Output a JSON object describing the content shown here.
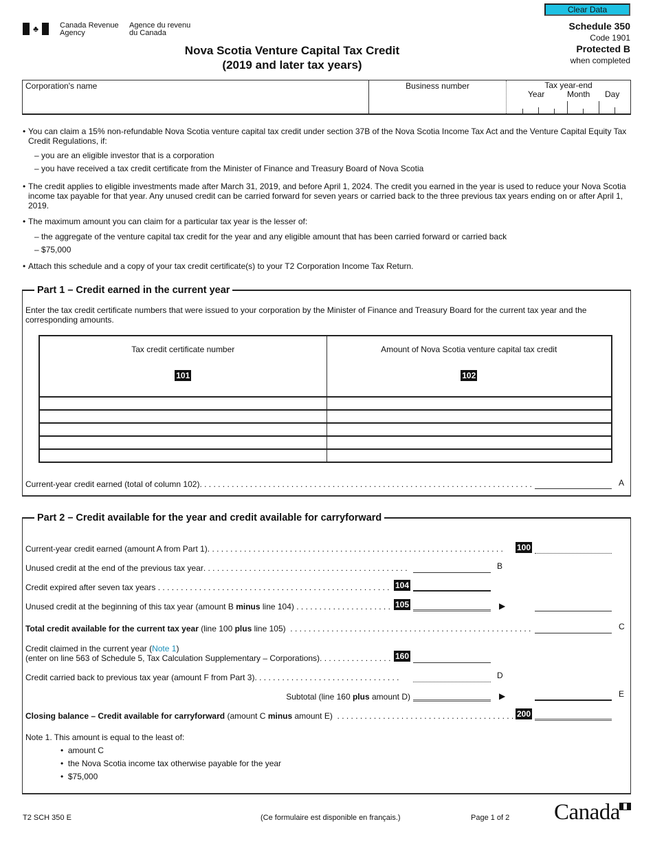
{
  "header": {
    "agency_en_line1": "Canada Revenue",
    "agency_en_line2": "Agency",
    "agency_fr_line1": "Agence du revenu",
    "agency_fr_line2": "du Canada",
    "clear_button": "Clear Data",
    "schedule": "Schedule 350",
    "code": "Code 1901",
    "protected": "Protected B",
    "when_completed": "when completed",
    "title_line1": "Nova Scotia Venture Capital Tax Credit",
    "title_line2": "(2019 and later tax years)"
  },
  "identification": {
    "corporation_name_label": "Corporation's name",
    "corporation_name_value": "",
    "business_number_label": "Business number",
    "business_number_value": "",
    "tax_year_end_label": "Tax year-end",
    "year_label": "Year",
    "month_label": "Month",
    "day_label": "Day"
  },
  "intro": {
    "bullet1": "You can claim a 15% non-refundable Nova Scotia venture capital tax credit under section 37B of the Nova Scotia Income Tax Act and the Venture Capital Equity Tax Credit Regulations, if:",
    "bullet1_sub1": "you are an eligible investor that is a corporation",
    "bullet1_sub2": "you have received a tax credit certificate from the Minister of Finance and Treasury Board of Nova Scotia",
    "bullet2": "The credit applies to eligible investments made after March 31, 2019, and before April 1, 2024. The credit you earned in the year is used to reduce your Nova Scotia income tax payable for that year. Any unused credit can be carried forward for seven years or carried back to the three previous tax years ending on or after April 1, 2019.",
    "bullet3": "The maximum amount you can claim for a particular tax year is the lesser of:",
    "bullet3_sub1": "the aggregate of the venture capital tax credit for the year and any eligible amount that has been carried forward or carried back",
    "bullet3_sub2": "$75,000",
    "bullet4": "Attach this schedule and a copy of your tax credit certificate(s) to your T2 Corporation Income Tax Return."
  },
  "part1": {
    "title": "Part 1 – Credit earned in the current year",
    "instructions": "Enter the tax credit certificate numbers that were issued to your corporation by the Minister of Finance and Treasury Board for the current tax year and the corresponding amounts.",
    "col1_header": "Tax credit certificate number",
    "col1_code": "101",
    "col2_header": "Amount of Nova Scotia venture capital tax credit",
    "col2_code": "102",
    "rows": [
      {
        "certificate": "",
        "amount": ""
      },
      {
        "certificate": "",
        "amount": ""
      },
      {
        "certificate": "",
        "amount": ""
      },
      {
        "certificate": "",
        "amount": ""
      },
      {
        "certificate": "",
        "amount": ""
      }
    ],
    "total_label": "Current-year credit earned (total of column 102)",
    "total_letter": "A",
    "total_value": ""
  },
  "part2": {
    "title": "Part 2 – Credit available for the year and credit available for carryforward",
    "line100_label": "Current-year credit earned (amount A from Part 1)",
    "line100_code": "100",
    "lineB_label": "Unused credit at the end of the previous tax year",
    "lineB_letter": "B",
    "line104_label": "Credit expired after seven tax years",
    "line104_code": "104",
    "line105_label_pre": "Unused credit at the beginning of this tax year (amount B ",
    "line105_label_bold": "minus",
    "line105_label_post": " line 104)",
    "line105_code": "105",
    "lineC_label_bold": "Total credit available for the current tax year",
    "lineC_label_pre": " (line 100 ",
    "lineC_label_bold2": "plus",
    "lineC_label_post": " line 105)",
    "lineC_letter": "C",
    "line160_label_pre": "Credit claimed in the current year (",
    "line160_note_link": "Note 1",
    "line160_label_post": ")",
    "line160_label_line2": "(enter on line 563 of Schedule 5, Tax Calculation Supplementary – Corporations)",
    "line160_code": "160",
    "lineD_label": "Credit carried back to previous tax year (amount F from Part 3)",
    "lineD_letter": "D",
    "lineE_label_pre": "Subtotal (line 160 ",
    "lineE_label_bold": "plus",
    "lineE_label_post": " amount D)",
    "lineE_letter": "E",
    "line200_label_bold": "Closing balance – Credit available for carryforward",
    "line200_label_pre": " (amount C ",
    "line200_label_bold2": "minus",
    "line200_label_post": " amount E)",
    "line200_code": "200",
    "note1_title": "Note 1. This amount is equal to the least of:",
    "note1_items": [
      "amount C",
      "the Nova Scotia income tax otherwise payable for the year",
      "$75,000"
    ]
  },
  "footer": {
    "form_id": "T2 SCH 350 E",
    "french_note": "(Ce formulaire est disponible en français.)",
    "page": "Page 1 of 2",
    "wordmark": "Canada"
  }
}
